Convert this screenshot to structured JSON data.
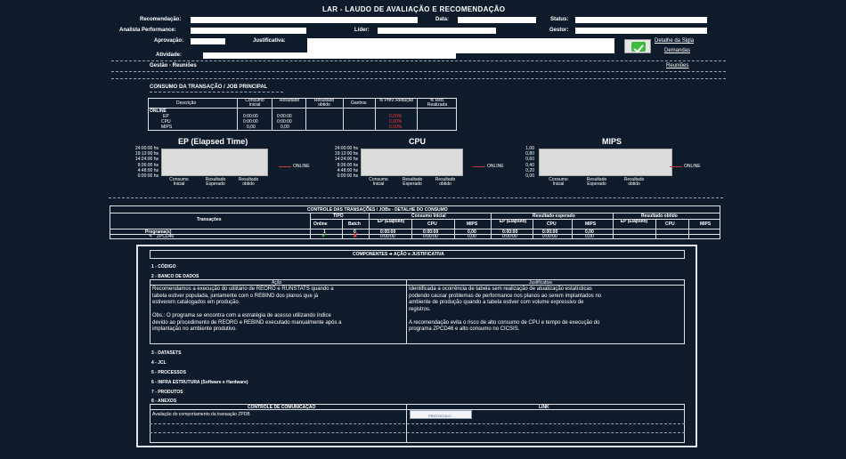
{
  "header": {
    "title": "LAR - LAUDO DE AVALIAÇÃO E RECOMENDAÇÃO",
    "labels": {
      "recomendacao": "Recomendação:",
      "data": "Data:",
      "status": "Status:",
      "analista": "Analista Performance:",
      "lider": "Líder:",
      "gestor": "Gestor:",
      "aprovacao": "Aprovação:",
      "justificativa": "Justificativa:",
      "atividade": "Atividade:"
    },
    "links": {
      "detalhe": "Detalhe da Sigla",
      "demandas": "Demandas",
      "reunioes": "Reuniões"
    },
    "gestao_label": "Gestão - Reuniões"
  },
  "consumo": {
    "section_title": "CONSUMO DA TRANSAÇÃO / JOB PRINCIPAL",
    "columns": [
      "Descrição",
      "Consumo Inicial",
      "Resultado",
      "Resultado obtido",
      "Ganhos",
      "% Prev. Redução",
      "% Red. Realizada"
    ],
    "rows": [
      {
        "label": "ONLINE",
        "inicial": "",
        "resultado": "",
        "pct": ""
      },
      {
        "label": "EP",
        "inicial": "0:00:00",
        "resultado": "0:00:00",
        "pct": "0,00%"
      },
      {
        "label": "CPU",
        "inicial": "0:00:00",
        "resultado": "0:00:00",
        "pct": "0,00%"
      },
      {
        "label": "MIPS",
        "inicial": "0,00",
        "resultado": "0,00",
        "pct": "0,00%"
      }
    ]
  },
  "charts": {
    "ep": {
      "title": "EP (Elapsed Time)",
      "yticks": [
        "24:00:00 hs",
        "19:12:00 hs",
        "14:24:00 hs",
        "9:36:00 hs",
        "4:48:00 hs",
        "0:00:00 hs"
      ],
      "xlabels": [
        "Consumo Inicial",
        "Resultado Esperado",
        "Resultado obtido"
      ],
      "legend": "ONLINE"
    },
    "cpu": {
      "title": "CPU",
      "yticks": [
        "24:00:00 hs",
        "19:12:00 hs",
        "14:24:00 hs",
        "9:36:00 hs",
        "4:48:00 hs",
        "0:00:00 hs"
      ],
      "xlabels": [
        "Consumo Inicial",
        "Resultado Esperado",
        "Resultado obtido"
      ],
      "legend": "ONLINE"
    },
    "mips": {
      "title": "MIPS",
      "yticks": [
        "1,00",
        "0,80",
        "0,60",
        "0,40",
        "0,20",
        "0,00"
      ],
      "xlabels": [
        "Consumo Inicial",
        "Resultado Esperado",
        "Resultado obtido"
      ],
      "legend": "ONLINE"
    }
  },
  "controle": {
    "title": "CONTROLE DAS TRANSAÇÕES / JOBs - DETALHE DO CONSUMO",
    "h_transacoes": "Transações",
    "h_tipo": "TIPO",
    "h_consumo_inicial": "Consumo Inicial",
    "h_resultado_esperado": "Resultado esperado",
    "h_resultado_obtido": "Resultado obtido",
    "h_online": "Online",
    "h_batch": "Batch",
    "h_ep": "EP (Elapsed)",
    "h_cpu": "CPU",
    "h_mips": "MIPS",
    "programas": {
      "label": "Programa(s)",
      "online": "1",
      "batch": "0",
      "ep1": "0:00:00",
      "cpu1": "0:00:00",
      "mips1": "0,00",
      "ep2": "0:00:00",
      "cpu2": "0:00:00",
      "mips2": "0,00"
    },
    "row": {
      "label": "ZPCD46",
      "ep1": "0:00:00",
      "cpu1": "0:00:00",
      "mips1": "0,00",
      "ep2": "0:00:00",
      "cpu2": "0:00:00",
      "mips2": "0,00"
    }
  },
  "componentes": {
    "title": "COMPONENTES ➔ AÇÃO e JUSTIFICATIVA",
    "items": [
      "1 - CÓDIGO",
      "2 - BANCO DE DADOS",
      "3 - DATASETS",
      "4 - JCL",
      "5 - PROCESSOS",
      "6 - INFRA ESTRUTURA (Software e Hardware)",
      "7 - PRODUTOS",
      "8 - ANEXOS"
    ],
    "acao_header": "Ação",
    "justificativa_header": "Justificativa",
    "acao_lines": [
      "Recomendamos a execução do utilitário de REORG e RUNSTATS quando a",
      "tabela estiver populada, juntamente com o REBIND dos planos que já",
      "estiverem catalogados em produção.",
      "",
      "Obs.: O programa se encontra com a estratégia de acesso utilizando índice",
      "devido ao procedimento de REORG e REBIND executado manualmente após a",
      "implantação no ambiente produtivo."
    ],
    "justificativa_lines": [
      "Identificada a ocorrência de tabela sem realização de atualização estatísticas",
      "podendo causar problemas de performance nos planos ao serem implantados no",
      "ambiente de produção quando a tabela estiver com volume expressivo de",
      "registros.",
      "",
      "A recomendação evita o risco de alto consumo de CPU e tempo de execução do",
      "programa ZPCD46 e alto consumo no CICSIS."
    ],
    "comunicacao_header": "CONTROLE DE COMUNICAÇÃO",
    "link_header": "LINK",
    "comunicacao_row": "Avaliação do comportamento da transação ZPDB",
    "link_thumb_text": "PROTOCOLO"
  }
}
